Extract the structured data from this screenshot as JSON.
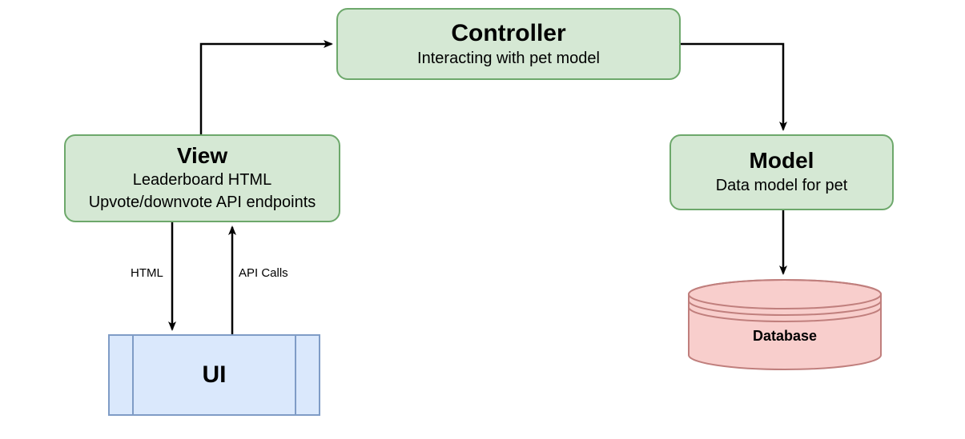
{
  "controller": {
    "title": "Controller",
    "subtitle": "Interacting with pet model"
  },
  "view": {
    "title": "View",
    "subtitle_line1": "Leaderboard HTML",
    "subtitle_line2": "Upvote/downvote API endpoints"
  },
  "model": {
    "title": "Model",
    "subtitle": "Data model for pet"
  },
  "ui": {
    "label": "UI"
  },
  "database": {
    "label": "Database"
  },
  "edges": {
    "html": "HTML",
    "api_calls": "API Calls"
  },
  "colors": {
    "green_fill": "#d5e8d4",
    "green_stroke": "#6da86b",
    "blue_fill": "#dae8fc",
    "blue_stroke": "#7f9cc6",
    "red_fill": "#f8cecc",
    "red_stroke": "#c07f7d"
  }
}
